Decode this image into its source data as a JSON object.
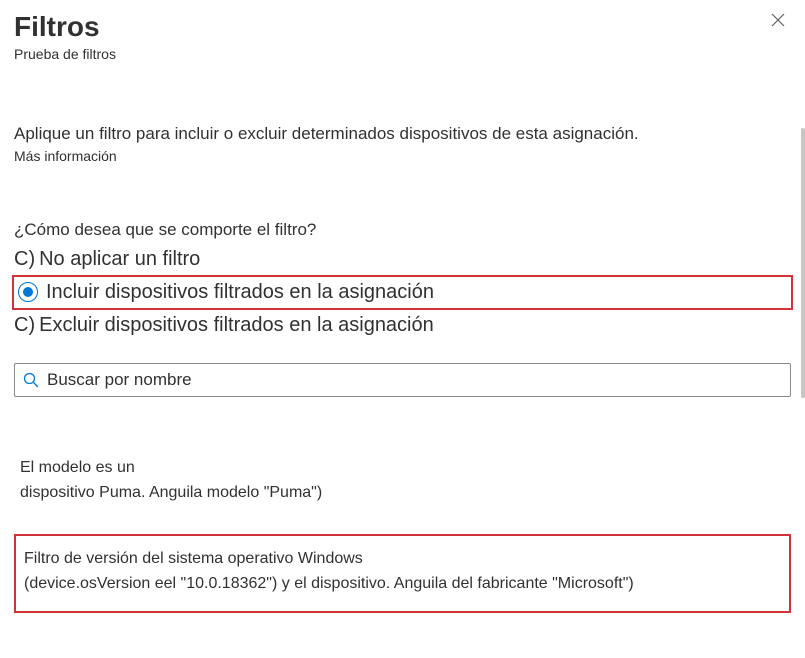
{
  "header": {
    "title": "Filtros",
    "subtitle": "Prueba de filtros"
  },
  "description": "Aplique un filtro para incluir o excluir determinados dispositivos de esta asignación.",
  "more_info": "Más información",
  "behavior_label": "¿Cómo desea que se comporte el filtro?",
  "radios": {
    "none_prefix": "C)",
    "none_label": "No aplicar un filtro",
    "include_label": "Incluir dispositivos filtrados en la asignación",
    "exclude_prefix": "C)",
    "exclude_label": "Excluir dispositivos filtrados en la asignación"
  },
  "search": {
    "placeholder": "Buscar por nombre"
  },
  "filters": {
    "block1_line1": "El modelo es un",
    "block1_line2": "dispositivo Puma. Anguila modelo \"Puma\")",
    "block2_line1": "Filtro de versión del sistema operativo Windows",
    "block2_line2": "(device.osVersion eel \"10.0.18362\") y el dispositivo. Anguila del fabricante \"Microsoft\")"
  }
}
